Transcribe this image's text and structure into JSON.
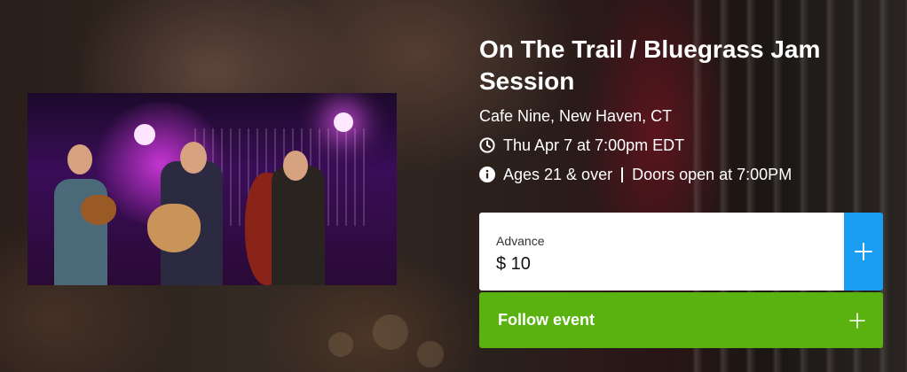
{
  "event": {
    "title": "On The Trail / Bluegrass Jam Session",
    "venue": "Cafe Nine, New Haven, CT",
    "datetime": "Thu Apr 7 at 7:00pm EDT",
    "ages": "Ages 21 & over",
    "doors": "Doors open at 7:00PM",
    "image_alt": "Three musicians performing on stage with guitar, mandolin and upright bass under purple lights"
  },
  "ticket": {
    "name": "Advance",
    "price": "$ 10",
    "add_icon": "plus-icon",
    "accent_color": "#1a9ef2"
  },
  "follow": {
    "label": "Follow event",
    "icon": "plus-icon",
    "color": "#5ab211"
  },
  "icons": {
    "date": "clock-icon",
    "info": "info-icon"
  }
}
